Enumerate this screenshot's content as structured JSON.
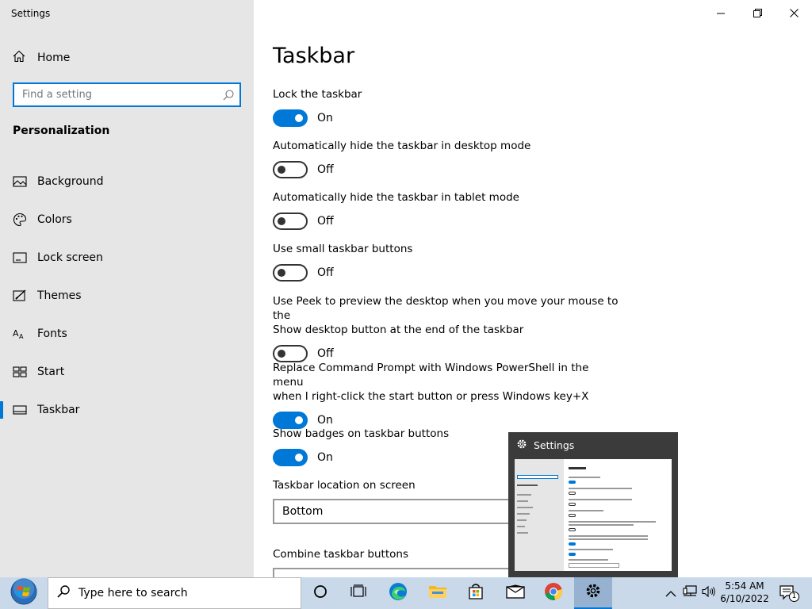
{
  "window": {
    "title": "Settings"
  },
  "sidebar": {
    "home_label": "Home",
    "search_placeholder": "Find a setting",
    "section_title": "Personalization",
    "items": [
      {
        "label": "Background",
        "icon": "picture-icon"
      },
      {
        "label": "Colors",
        "icon": "palette-icon"
      },
      {
        "label": "Lock screen",
        "icon": "lock-screen-icon"
      },
      {
        "label": "Themes",
        "icon": "themes-icon"
      },
      {
        "label": "Fonts",
        "icon": "fonts-icon"
      },
      {
        "label": "Start",
        "icon": "start-grid-icon"
      },
      {
        "label": "Taskbar",
        "icon": "taskbar-icon",
        "active": true
      }
    ]
  },
  "main": {
    "title": "Taskbar",
    "settings": [
      {
        "label": "Lock the taskbar",
        "state": "On"
      },
      {
        "label": "Automatically hide the taskbar in desktop mode",
        "state": "Off"
      },
      {
        "label": "Automatically hide the taskbar in tablet mode",
        "state": "Off"
      },
      {
        "label": "Use small taskbar buttons",
        "state": "Off"
      },
      {
        "label_line1": "Use Peek to preview the desktop when you move your mouse to the",
        "label_line2": "Show desktop button at the end of the taskbar",
        "state": "Off"
      },
      {
        "label_line1": "Replace Command Prompt with Windows PowerShell in the menu",
        "label_line2": "when I right-click the start button or press Windows key+X",
        "state": "On"
      },
      {
        "label": "Show badges on taskbar buttons",
        "state": "On"
      }
    ],
    "location_label": "Taskbar location on screen",
    "location_value": "Bottom",
    "combine_label": "Combine taskbar buttons"
  },
  "preview": {
    "title": "Settings"
  },
  "taskbar": {
    "search_placeholder": "Type here to search",
    "time": "5:54 AM",
    "date": "6/10/2022",
    "notification_count": "1"
  },
  "colors": {
    "accent": "#0078d7",
    "sidebar_bg": "#e6e6e6",
    "taskbar_bg": "#c9d9ea"
  }
}
